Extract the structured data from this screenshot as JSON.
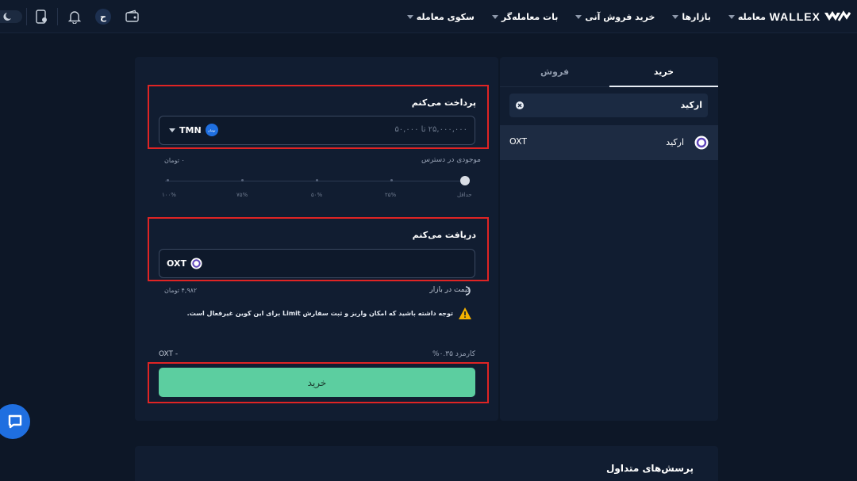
{
  "header": {
    "brand": "WALLEX",
    "nav": [
      {
        "label": "معامله",
        "has_caret": true
      },
      {
        "label": "بازارها",
        "has_caret": true
      },
      {
        "label": "خرید فروش آنی",
        "has_caret": true
      },
      {
        "label": "بات معامله‌گر",
        "has_caret": true
      },
      {
        "label": "سکوی معامله",
        "has_caret": true
      }
    ],
    "avatar_letter": "ح"
  },
  "order": {
    "pay_title": "پرداخت می‌کنم",
    "pay_placeholder": "۲۵,۰۰۰,۰۰۰ تا ۵۰,۰۰۰",
    "pay_currency": "TMN",
    "pay_badge": "تومان",
    "balance_label": "موجودی در دسترس",
    "balance_value": "۰ تومان",
    "slider_labels": [
      "حداقل",
      "۲۵%",
      "۵۰%",
      "۷۵%",
      "۱۰۰%"
    ],
    "receive_title": "دریافت می‌کنم",
    "receive_currency": "OXT",
    "market_price_label": "قیمت در بازار",
    "market_price_value": "۴,۹۸۲ تومان",
    "warning": "توجه داشته باشید که امکان واریز و ثبت سفارش Limit برای این کوین غیرفعال است.",
    "fee_label": "کارمزد ۰.۳۵%",
    "fee_value": "- OXT",
    "buy_button": "خرید"
  },
  "side": {
    "tab_buy": "خرید",
    "tab_sell": "فروش",
    "search_value": "ارکید",
    "results": [
      {
        "name": "ارکید",
        "symbol": "OXT"
      }
    ]
  },
  "faq": {
    "title": "پرسش‌های متداول"
  },
  "colors": {
    "background": "#0d1727",
    "panel": "#111d31",
    "accent_green": "#5ccea0",
    "highlight_red": "#e02424",
    "warning": "#f5b300"
  }
}
